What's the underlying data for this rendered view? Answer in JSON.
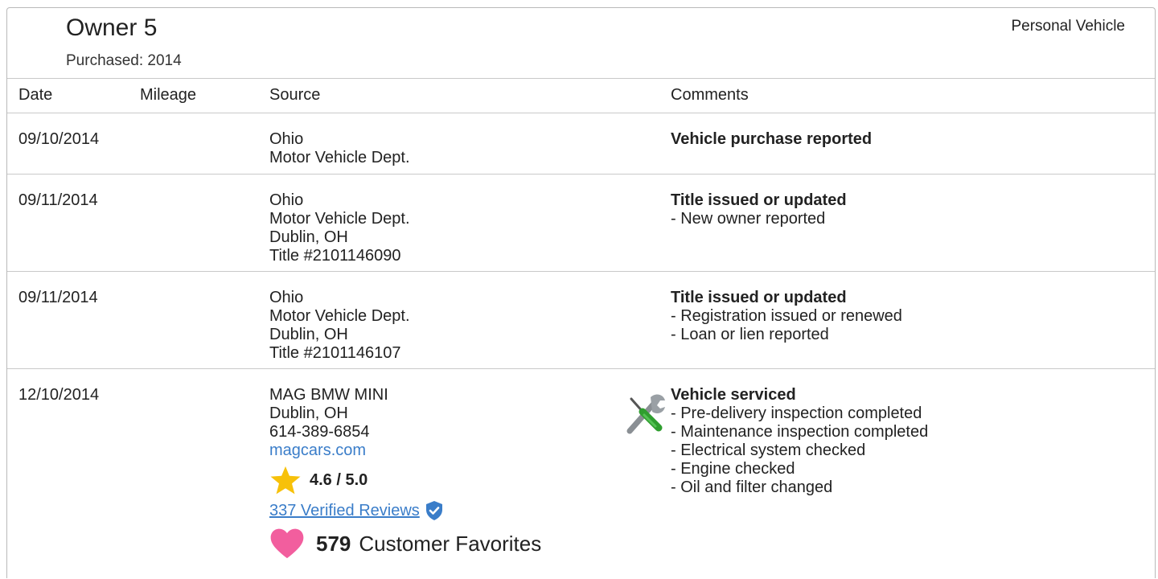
{
  "owner": {
    "title": "Owner 5",
    "purchased": "Purchased: 2014",
    "type": "Personal Vehicle"
  },
  "columns": {
    "date": "Date",
    "mileage": "Mileage",
    "source": "Source",
    "comments": "Comments"
  },
  "rows": [
    {
      "date": "09/10/2014",
      "source": [
        "Ohio",
        "Motor Vehicle Dept."
      ],
      "comment_title": "Vehicle purchase reported",
      "comment_items": []
    },
    {
      "date": "09/11/2014",
      "source": [
        "Ohio",
        "Motor Vehicle Dept.",
        "Dublin, OH",
        "Title #2101146090"
      ],
      "comment_title": "Title issued or updated",
      "comment_items": [
        "- New owner reported"
      ]
    },
    {
      "date": "09/11/2014",
      "source": [
        "Ohio",
        "Motor Vehicle Dept.",
        "Dublin, OH",
        "Title #2101146107"
      ],
      "comment_title": "Title issued or updated",
      "comment_items": [
        "- Registration issued or renewed",
        "- Loan or lien reported"
      ]
    },
    {
      "date": "12/10/2014",
      "source": [
        "MAG BMW MINI",
        "Dublin, OH",
        "614-389-6854"
      ],
      "source_link": "magcars.com",
      "rating": "4.6 / 5.0",
      "reviews": "337 Verified Reviews",
      "favorites_count": "579",
      "favorites_label": "Customer Favorites",
      "comment_title": "Vehicle serviced",
      "comment_items": [
        "- Pre-delivery inspection completed",
        "- Maintenance inspection completed",
        "- Electrical system checked",
        "- Engine checked",
        "- Oil and filter changed"
      ]
    }
  ],
  "icons": {
    "star": "star-icon",
    "verified": "verified-shield-icon",
    "heart": "heart-icon",
    "service": "wrench-screwdriver-icon"
  },
  "colors": {
    "link": "#3a7dc9",
    "star": "#f7c10a",
    "heart": "#f25e9e",
    "verified": "#3a7dc9",
    "border": "#c9c9c9"
  }
}
